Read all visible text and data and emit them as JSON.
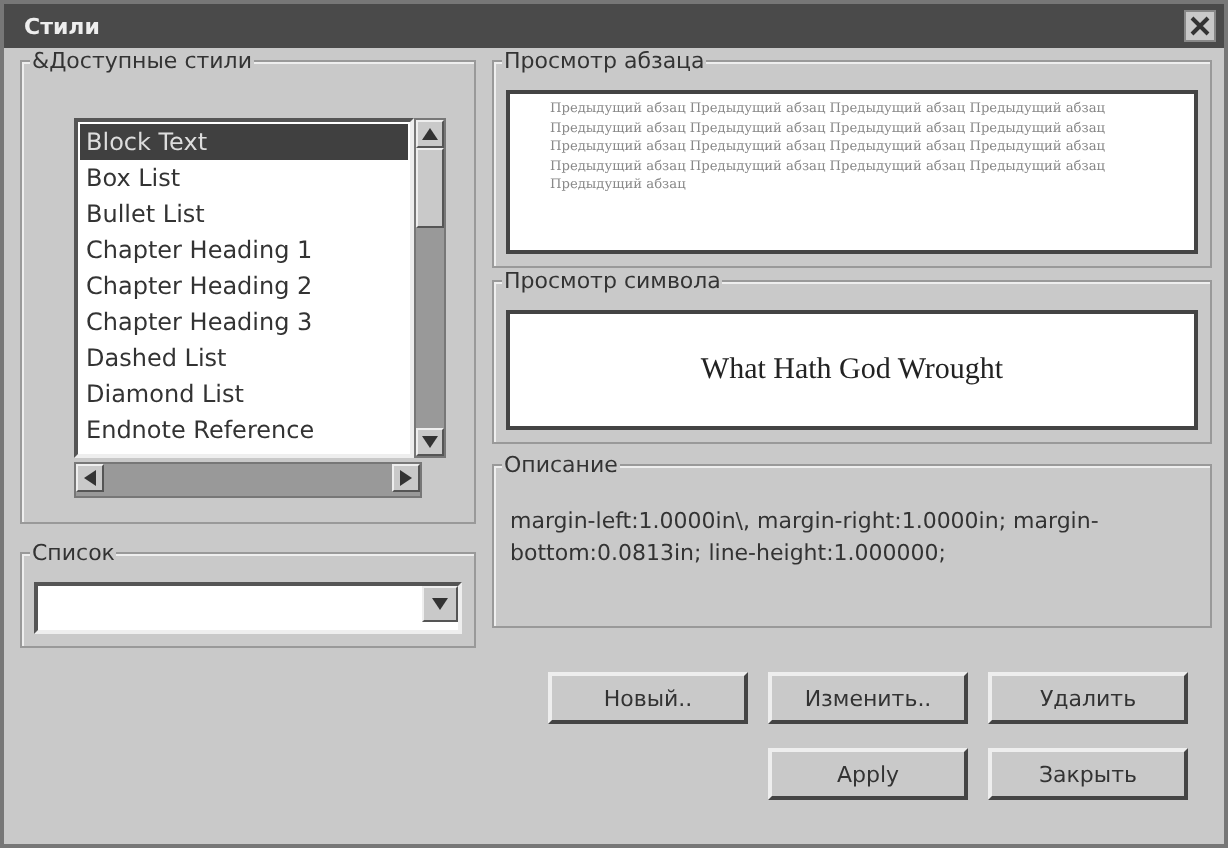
{
  "window": {
    "title": "Стили"
  },
  "styles_group": {
    "label": "&Доступные стили",
    "items": [
      {
        "label": "Block Text",
        "selected": true
      },
      {
        "label": "Box List",
        "selected": false
      },
      {
        "label": "Bullet List",
        "selected": false
      },
      {
        "label": "Chapter Heading 1",
        "selected": false
      },
      {
        "label": "Chapter Heading 2",
        "selected": false
      },
      {
        "label": "Chapter Heading 3",
        "selected": false
      },
      {
        "label": "Dashed List",
        "selected": false
      },
      {
        "label": "Diamond List",
        "selected": false
      },
      {
        "label": "Endnote Reference",
        "selected": false
      }
    ]
  },
  "list_group": {
    "label": "Список"
  },
  "paragraph_preview": {
    "label": "Просмотр абзаца",
    "text": "Предыдущий абзац Предыдущий абзац Предыдущий абзац Предыдущий абзац Предыдущий абзац Предыдущий абзац Предыдущий абзац Предыдущий абзац Предыдущий абзац Предыдущий абзац Предыдущий абзац Предыдущий абзац Предыдущий абзац Предыдущий абзац Предыдущий абзац Предыдущий абзац Предыдущий абзац"
  },
  "character_preview": {
    "label": "Просмотр символа",
    "text": "What Hath God Wrought"
  },
  "description": {
    "label": "Описание",
    "text": "margin-left:1.0000in\\, margin-right:1.0000in; margin-bottom:0.0813in; line-height:1.000000;"
  },
  "buttons": [
    {
      "label": "Новый.."
    },
    {
      "label": "Изменить.."
    },
    {
      "label": "Удалить"
    }
  ],
  "bottom_buttons": [
    {
      "label": "Apply"
    },
    {
      "label": "Закрыть"
    }
  ]
}
